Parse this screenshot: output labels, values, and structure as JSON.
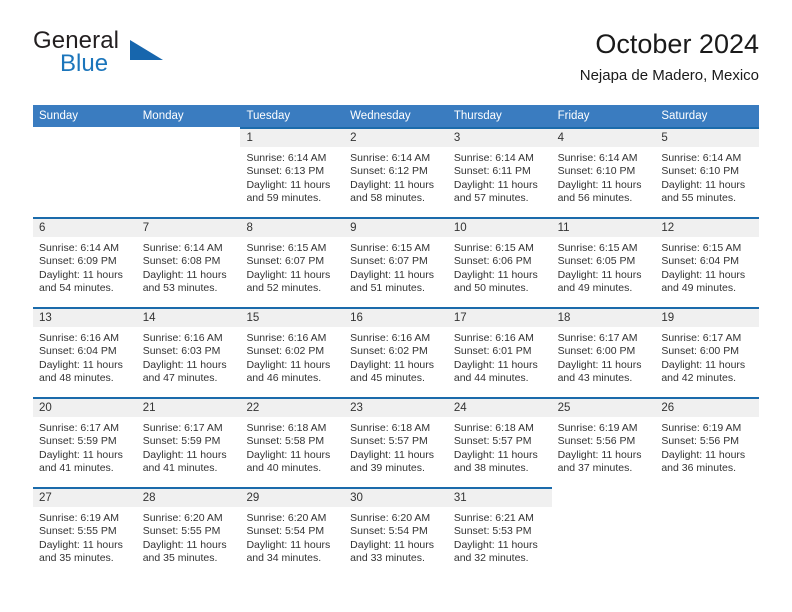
{
  "brand": {
    "name_part1": "General",
    "name_part2": "Blue",
    "triangle_color": "#1766ad",
    "blue": "#1b75bb"
  },
  "header": {
    "title": "October 2024",
    "subtitle": "Nejapa de Madero, Mexico"
  },
  "theme": {
    "header_blue": "#3a7cc0",
    "separator_blue": "#1b6bab",
    "daynum_band": "#f0f0f0",
    "text": "#333333"
  },
  "weekdays": [
    "Sunday",
    "Monday",
    "Tuesday",
    "Wednesday",
    "Thursday",
    "Friday",
    "Saturday"
  ],
  "weeks": [
    [
      {
        "day": "",
        "lines": []
      },
      {
        "day": "",
        "lines": []
      },
      {
        "day": "1",
        "lines": [
          "Sunrise: 6:14 AM",
          "Sunset: 6:13 PM",
          "Daylight: 11 hours",
          "and 59 minutes."
        ]
      },
      {
        "day": "2",
        "lines": [
          "Sunrise: 6:14 AM",
          "Sunset: 6:12 PM",
          "Daylight: 11 hours",
          "and 58 minutes."
        ]
      },
      {
        "day": "3",
        "lines": [
          "Sunrise: 6:14 AM",
          "Sunset: 6:11 PM",
          "Daylight: 11 hours",
          "and 57 minutes."
        ]
      },
      {
        "day": "4",
        "lines": [
          "Sunrise: 6:14 AM",
          "Sunset: 6:10 PM",
          "Daylight: 11 hours",
          "and 56 minutes."
        ]
      },
      {
        "day": "5",
        "lines": [
          "Sunrise: 6:14 AM",
          "Sunset: 6:10 PM",
          "Daylight: 11 hours",
          "and 55 minutes."
        ]
      }
    ],
    [
      {
        "day": "6",
        "lines": [
          "Sunrise: 6:14 AM",
          "Sunset: 6:09 PM",
          "Daylight: 11 hours",
          "and 54 minutes."
        ]
      },
      {
        "day": "7",
        "lines": [
          "Sunrise: 6:14 AM",
          "Sunset: 6:08 PM",
          "Daylight: 11 hours",
          "and 53 minutes."
        ]
      },
      {
        "day": "8",
        "lines": [
          "Sunrise: 6:15 AM",
          "Sunset: 6:07 PM",
          "Daylight: 11 hours",
          "and 52 minutes."
        ]
      },
      {
        "day": "9",
        "lines": [
          "Sunrise: 6:15 AM",
          "Sunset: 6:07 PM",
          "Daylight: 11 hours",
          "and 51 minutes."
        ]
      },
      {
        "day": "10",
        "lines": [
          "Sunrise: 6:15 AM",
          "Sunset: 6:06 PM",
          "Daylight: 11 hours",
          "and 50 minutes."
        ]
      },
      {
        "day": "11",
        "lines": [
          "Sunrise: 6:15 AM",
          "Sunset: 6:05 PM",
          "Daylight: 11 hours",
          "and 49 minutes."
        ]
      },
      {
        "day": "12",
        "lines": [
          "Sunrise: 6:15 AM",
          "Sunset: 6:04 PM",
          "Daylight: 11 hours",
          "and 49 minutes."
        ]
      }
    ],
    [
      {
        "day": "13",
        "lines": [
          "Sunrise: 6:16 AM",
          "Sunset: 6:04 PM",
          "Daylight: 11 hours",
          "and 48 minutes."
        ]
      },
      {
        "day": "14",
        "lines": [
          "Sunrise: 6:16 AM",
          "Sunset: 6:03 PM",
          "Daylight: 11 hours",
          "and 47 minutes."
        ]
      },
      {
        "day": "15",
        "lines": [
          "Sunrise: 6:16 AM",
          "Sunset: 6:02 PM",
          "Daylight: 11 hours",
          "and 46 minutes."
        ]
      },
      {
        "day": "16",
        "lines": [
          "Sunrise: 6:16 AM",
          "Sunset: 6:02 PM",
          "Daylight: 11 hours",
          "and 45 minutes."
        ]
      },
      {
        "day": "17",
        "lines": [
          "Sunrise: 6:16 AM",
          "Sunset: 6:01 PM",
          "Daylight: 11 hours",
          "and 44 minutes."
        ]
      },
      {
        "day": "18",
        "lines": [
          "Sunrise: 6:17 AM",
          "Sunset: 6:00 PM",
          "Daylight: 11 hours",
          "and 43 minutes."
        ]
      },
      {
        "day": "19",
        "lines": [
          "Sunrise: 6:17 AM",
          "Sunset: 6:00 PM",
          "Daylight: 11 hours",
          "and 42 minutes."
        ]
      }
    ],
    [
      {
        "day": "20",
        "lines": [
          "Sunrise: 6:17 AM",
          "Sunset: 5:59 PM",
          "Daylight: 11 hours",
          "and 41 minutes."
        ]
      },
      {
        "day": "21",
        "lines": [
          "Sunrise: 6:17 AM",
          "Sunset: 5:59 PM",
          "Daylight: 11 hours",
          "and 41 minutes."
        ]
      },
      {
        "day": "22",
        "lines": [
          "Sunrise: 6:18 AM",
          "Sunset: 5:58 PM",
          "Daylight: 11 hours",
          "and 40 minutes."
        ]
      },
      {
        "day": "23",
        "lines": [
          "Sunrise: 6:18 AM",
          "Sunset: 5:57 PM",
          "Daylight: 11 hours",
          "and 39 minutes."
        ]
      },
      {
        "day": "24",
        "lines": [
          "Sunrise: 6:18 AM",
          "Sunset: 5:57 PM",
          "Daylight: 11 hours",
          "and 38 minutes."
        ]
      },
      {
        "day": "25",
        "lines": [
          "Sunrise: 6:19 AM",
          "Sunset: 5:56 PM",
          "Daylight: 11 hours",
          "and 37 minutes."
        ]
      },
      {
        "day": "26",
        "lines": [
          "Sunrise: 6:19 AM",
          "Sunset: 5:56 PM",
          "Daylight: 11 hours",
          "and 36 minutes."
        ]
      }
    ],
    [
      {
        "day": "27",
        "lines": [
          "Sunrise: 6:19 AM",
          "Sunset: 5:55 PM",
          "Daylight: 11 hours",
          "and 35 minutes."
        ]
      },
      {
        "day": "28",
        "lines": [
          "Sunrise: 6:20 AM",
          "Sunset: 5:55 PM",
          "Daylight: 11 hours",
          "and 35 minutes."
        ]
      },
      {
        "day": "29",
        "lines": [
          "Sunrise: 6:20 AM",
          "Sunset: 5:54 PM",
          "Daylight: 11 hours",
          "and 34 minutes."
        ]
      },
      {
        "day": "30",
        "lines": [
          "Sunrise: 6:20 AM",
          "Sunset: 5:54 PM",
          "Daylight: 11 hours",
          "and 33 minutes."
        ]
      },
      {
        "day": "31",
        "lines": [
          "Sunrise: 6:21 AM",
          "Sunset: 5:53 PM",
          "Daylight: 11 hours",
          "and 32 minutes."
        ]
      },
      {
        "day": "",
        "lines": []
      },
      {
        "day": "",
        "lines": []
      }
    ]
  ]
}
